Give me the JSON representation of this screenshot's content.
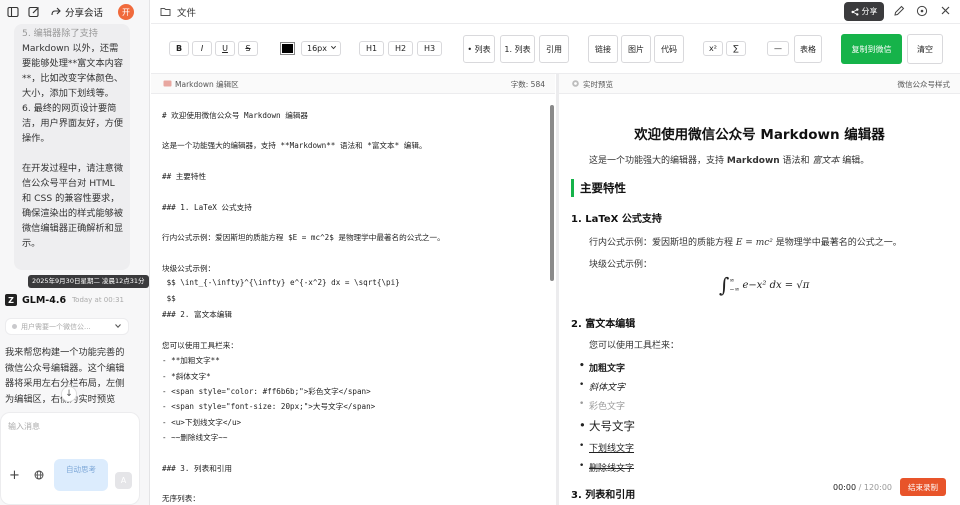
{
  "chat": {
    "header": {
      "share_label": "分享会话",
      "avatar_letter": "开"
    },
    "user_message_lines": [
      {
        "text": "5. 编辑器除了支持",
        "faded": true
      },
      {
        "text": "Markdown 以外，还需"
      },
      {
        "text": "要能够处理**富文本内容"
      },
      {
        "text": "**，比如改变字体颜色、"
      },
      {
        "text": "大小，添加下划线等。"
      },
      {
        "text": "6. 最终的网页设计要简"
      },
      {
        "text": "洁，用户界面友好，方便"
      },
      {
        "text": "操作。"
      },
      {
        "text": ""
      },
      {
        "text": "在开发过程中，请注意微"
      },
      {
        "text": "信公众号平台对 HTML"
      },
      {
        "text": "和 CSS 的兼容性要求，"
      },
      {
        "text": "确保渲染出的样式能够被"
      },
      {
        "text": "微信编辑器正确解析和显"
      },
      {
        "text": "示。"
      }
    ],
    "timestamp_tooltip": "2025年9月30日星期二 凌晨12点31分",
    "model_name": "GLM-4.6",
    "model_time": "Today at 00:31",
    "thinking_summary": "用户需要一个微信公...",
    "reply_lines": [
      "我来帮您构建一个功能完善的",
      "微信公众号编辑器。这个编辑",
      "器将采用左右分栏布局，左侧",
      "为编辑区，右侧为实时预览"
    ],
    "scroll_down_glyph": "↓",
    "input_placeholder": "输入消息",
    "auto_think_label": "自动思考",
    "send_glyph": "A"
  },
  "header": {
    "file_label": "文件",
    "share_label": "分享"
  },
  "toolbar": {
    "bold": "B",
    "italic": "I",
    "underline": "U",
    "strike": "S",
    "font_size": "16px",
    "text_color": "#000000",
    "h1": "H1",
    "h2": "H2",
    "h3": "H3",
    "ul": "• 列表",
    "ol": "1. 列表",
    "quote": "引用",
    "link": "链接",
    "image": "图片",
    "code": "代码",
    "superscript": "x²",
    "sum": "∑",
    "hr": "—",
    "table": "表格",
    "copy": "复制到微信",
    "clear": "清空"
  },
  "editor": {
    "title": "Markdown 编辑区",
    "char_count": "字数: 584",
    "lines": [
      "# 欢迎使用微信公众号 Markdown 编辑器",
      "",
      "这是一个功能强大的编辑器，支持 **Markdown** 语法和 *富文本* 编辑。",
      "",
      "## 主要特性",
      "",
      "### 1. LaTeX 公式支持",
      "",
      "行内公式示例：爱因斯坦的质能方程 $E = mc^2$ 是物理学中最著名的公式之一。",
      "",
      "块级公式示例：",
      " $$ \\int_{-\\infty}^{\\infty} e^{-x^2} dx = \\sqrt{\\pi}",
      " $$",
      "### 2. 富文本编辑",
      "",
      "您可以使用工具栏来：",
      "- **加粗文字**",
      "- *斜体文字*",
      "- <span style=\"color: #ff6b6b;\">彩色文字</span>",
      "- <span style=\"font-size: 20px;\">大号文字</span>",
      "- <u>下划线文字</u>",
      "- ~~删除线文字~~",
      "",
      "### 3. 列表和引用",
      "",
      "无序列表："
    ]
  },
  "preview": {
    "title": "实时预览",
    "style_label": "微信公众号样式",
    "h1": "欢迎使用微信公众号 Markdown 编辑器",
    "intro_prefix": "这是一个功能强大的编辑器，支持 ",
    "intro_bold": "Markdown",
    "intro_mid": " 语法和 ",
    "intro_italic": "富文本",
    "intro_suffix": " 编辑。",
    "h2_features": "主要特性",
    "h3_latex": "1. LaTeX 公式支持",
    "inline_prefix": "行内公式示例：爱因斯坦的质能方程 ",
    "inline_formula": "E = mc²",
    "inline_suffix": " 是物理学中最著名的公式之一。",
    "block_label": "块级公式示例：",
    "block_formula": {
      "upper": "∞",
      "lower": "−∞",
      "integral": "∫",
      "body": "e^{−x²} dx = √π",
      "body_display": "e−x² dx = √π"
    },
    "h3_rich": "2. 富文本编辑",
    "toolbar_hint": "您可以使用工具栏来：",
    "items": {
      "bold": "加粗文字",
      "italic": "斜体文字",
      "colored": "彩色文字",
      "big": "大号文字",
      "underline": "下划线文字",
      "strike": "删除线文字"
    },
    "h3_list": "3. 列表和引用",
    "accent_color": "#16b34a"
  },
  "recorder": {
    "elapsed": "00:00",
    "total": "/ 120:00",
    "stop_label": "结束录制"
  }
}
